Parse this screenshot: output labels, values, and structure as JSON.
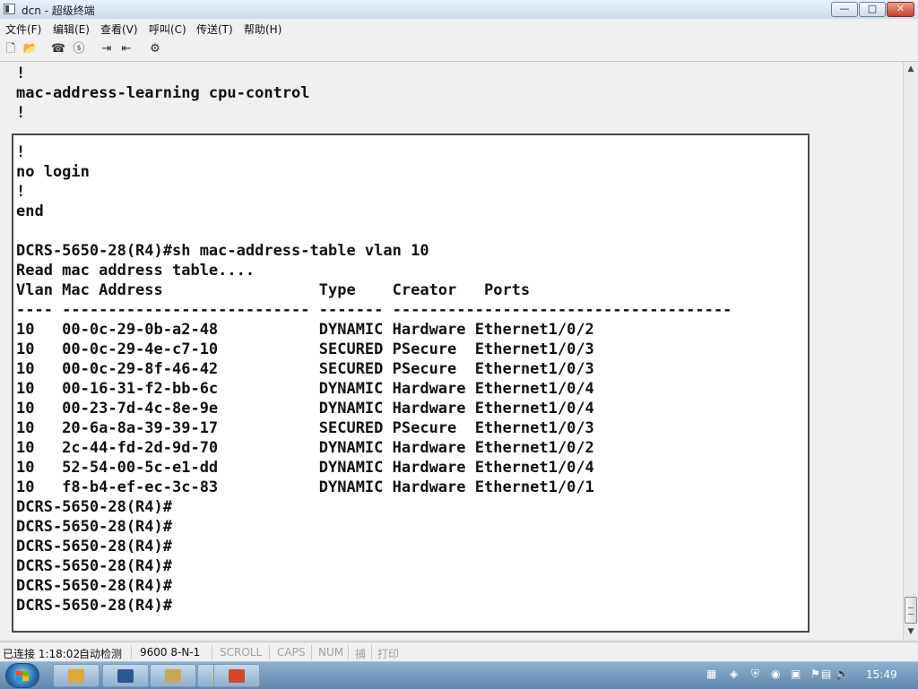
{
  "window": {
    "title": "dcn - 超级终端",
    "buttons": {
      "minimize": "—",
      "maximize": "□",
      "close": "✕"
    }
  },
  "menu": [
    "文件(F)",
    "编辑(E)",
    "查看(V)",
    "呼叫(C)",
    "传送(T)",
    "帮助(H)"
  ],
  "toolbar": [
    "new-document-icon",
    "open-folder-icon",
    "connect-phone-icon",
    "disconnect-icon",
    "send-file-icon",
    "receive-file-icon",
    "properties-icon"
  ],
  "terminal": {
    "top_lines": "!\nmac-address-learning cpu-control\n!",
    "main_lines": "!\nno login\n!\nend\n\nDCRS-5650-28(R4)#sh mac-address-table vlan 10\nRead mac address table....\nVlan Mac Address                 Type    Creator   Ports\n---- --------------------------- ------- -------------------------------------\n10   00-0c-29-0b-a2-48           DYNAMIC Hardware Ethernet1/0/2\n10   00-0c-29-4e-c7-10           SECURED PSecure  Ethernet1/0/3\n10   00-0c-29-8f-46-42           SECURED PSecure  Ethernet1/0/3\n10   00-16-31-f2-bb-6c           DYNAMIC Hardware Ethernet1/0/4\n10   00-23-7d-4c-8e-9e           DYNAMIC Hardware Ethernet1/0/4\n10   20-6a-8a-39-39-17           SECURED PSecure  Ethernet1/0/3\n10   2c-44-fd-2d-9d-70           DYNAMIC Hardware Ethernet1/0/2\n10   52-54-00-5c-e1-dd           DYNAMIC Hardware Ethernet1/0/4\n10   f8-b4-ef-ec-3c-83           DYNAMIC Hardware Ethernet1/0/1\nDCRS-5650-28(R4)#\nDCRS-5650-28(R4)#\nDCRS-5650-28(R4)#\nDCRS-5650-28(R4)#\nDCRS-5650-28(R4)#\nDCRS-5650-28(R4)#"
  },
  "status": {
    "connected": "已连接 1:18:02",
    "detect": "自动检测",
    "port_settings": "9600 8-N-1",
    "scroll": "SCROLL",
    "caps": "CAPS",
    "num": "NUM",
    "capture": "捕",
    "print": "打印"
  },
  "taskbar": {
    "clock": "15:49",
    "apps": [
      "explorer-icon",
      "word-icon",
      "file-manager-icon",
      "hyperterminal-icon",
      "powerpoint-icon"
    ]
  },
  "colors": {
    "terminal_bg": "#ffffff",
    "window_bg": "#f0f0f0",
    "taskbar": "#6f95bb"
  }
}
